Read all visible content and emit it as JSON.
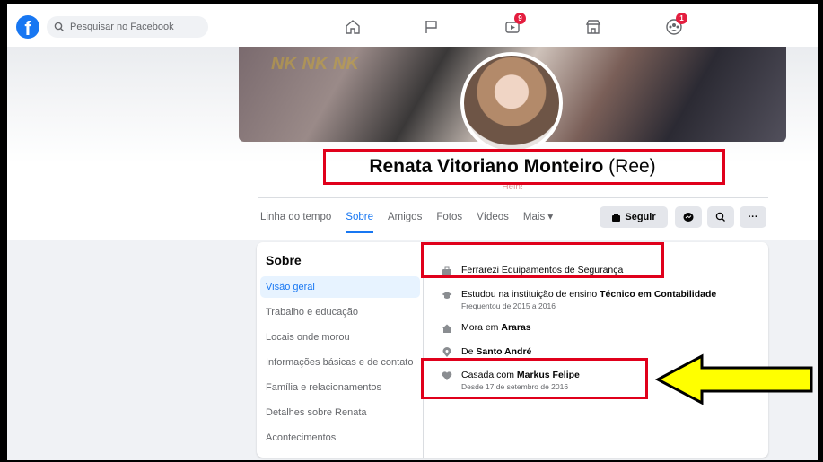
{
  "nav": {
    "search_placeholder": "Pesquisar no Facebook",
    "watch_badge": "9",
    "groups_badge": "1"
  },
  "profile": {
    "cover_text": "NK NK NK",
    "name": "Renata Vitoriano Monteiro",
    "nickname": "(Ree)",
    "subtitle": "Hein!"
  },
  "tabs": [
    {
      "label": "Linha do tempo"
    },
    {
      "label": "Sobre",
      "active": true
    },
    {
      "label": "Amigos"
    },
    {
      "label": "Fotos"
    },
    {
      "label": "Vídeos"
    },
    {
      "label": "Mais ▾"
    }
  ],
  "actions": {
    "follow_label": "Seguir",
    "more_label": "···"
  },
  "about": {
    "title": "Sobre",
    "menu": [
      "Visão geral",
      "Trabalho e educação",
      "Locais onde morou",
      "Informações básicas e de contato",
      "Família e relacionamentos",
      "Detalhes sobre Renata",
      "Acontecimentos"
    ],
    "work": "Ferrarezi Equipamentos de Segurança",
    "education_prefix": "Estudou na instituição de ensino",
    "education_name": "Técnico em Contabilidade",
    "education_period": "Frequentou de 2015 a 2016",
    "lives_prefix": "Mora em",
    "lives_city": "Araras",
    "from_prefix": "De",
    "from_city": "Santo André",
    "relationship_prefix": "Casada com",
    "relationship_partner": "Markus Felipe",
    "relationship_since": "Desde 17 de setembro de 2016"
  },
  "colors": {
    "brand": "#1877f2",
    "highlight_box": "#e0001b",
    "arrow_fill": "#ffff00"
  },
  "icons": [
    "facebook-logo-icon",
    "search-icon",
    "home-icon",
    "flag-icon",
    "watch-icon",
    "marketplace-icon",
    "groups-icon",
    "messenger-icon",
    "briefcase-icon",
    "graduation-cap-icon",
    "house-icon",
    "location-pin-icon",
    "heart-icon",
    "arrow-icon"
  ]
}
